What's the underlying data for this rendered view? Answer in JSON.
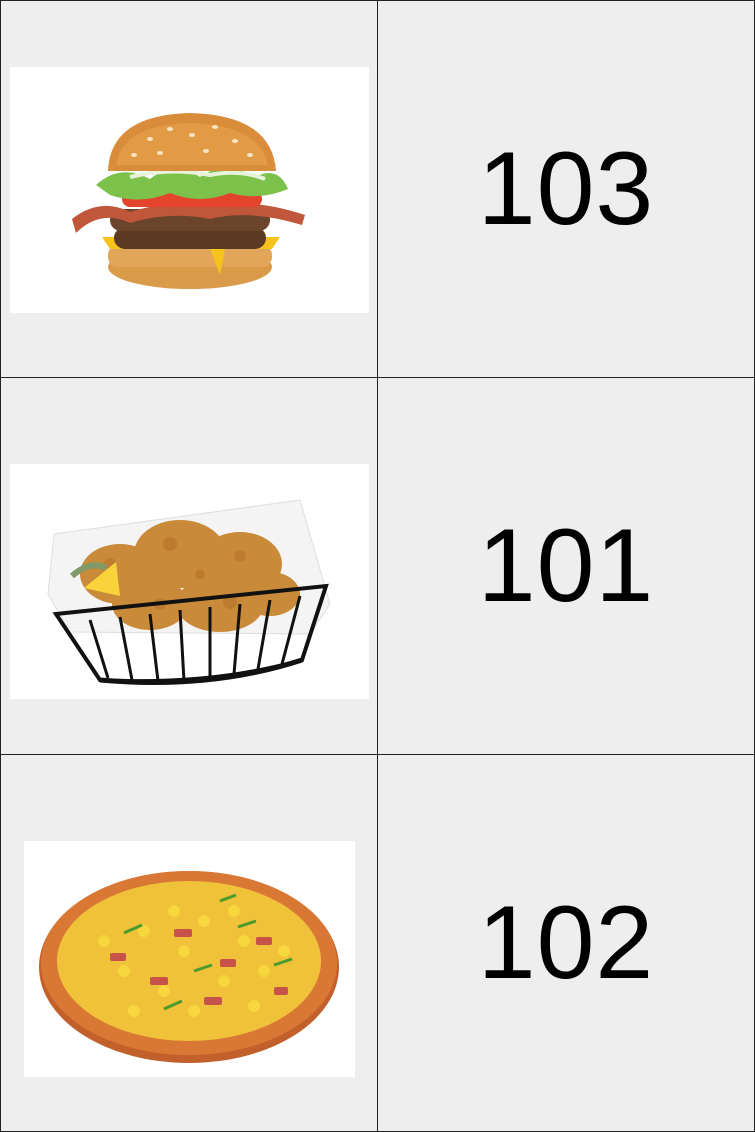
{
  "rows": [
    {
      "food_icon": "burger-icon",
      "number": "103"
    },
    {
      "food_icon": "fried-chicken-icon",
      "number": "101"
    },
    {
      "food_icon": "pizza-icon",
      "number": "102"
    }
  ],
  "colors": {
    "cell_background": "#eeeeee",
    "grid_line": "#222222",
    "photo_background": "#ffffff",
    "number_text": "#000000"
  }
}
